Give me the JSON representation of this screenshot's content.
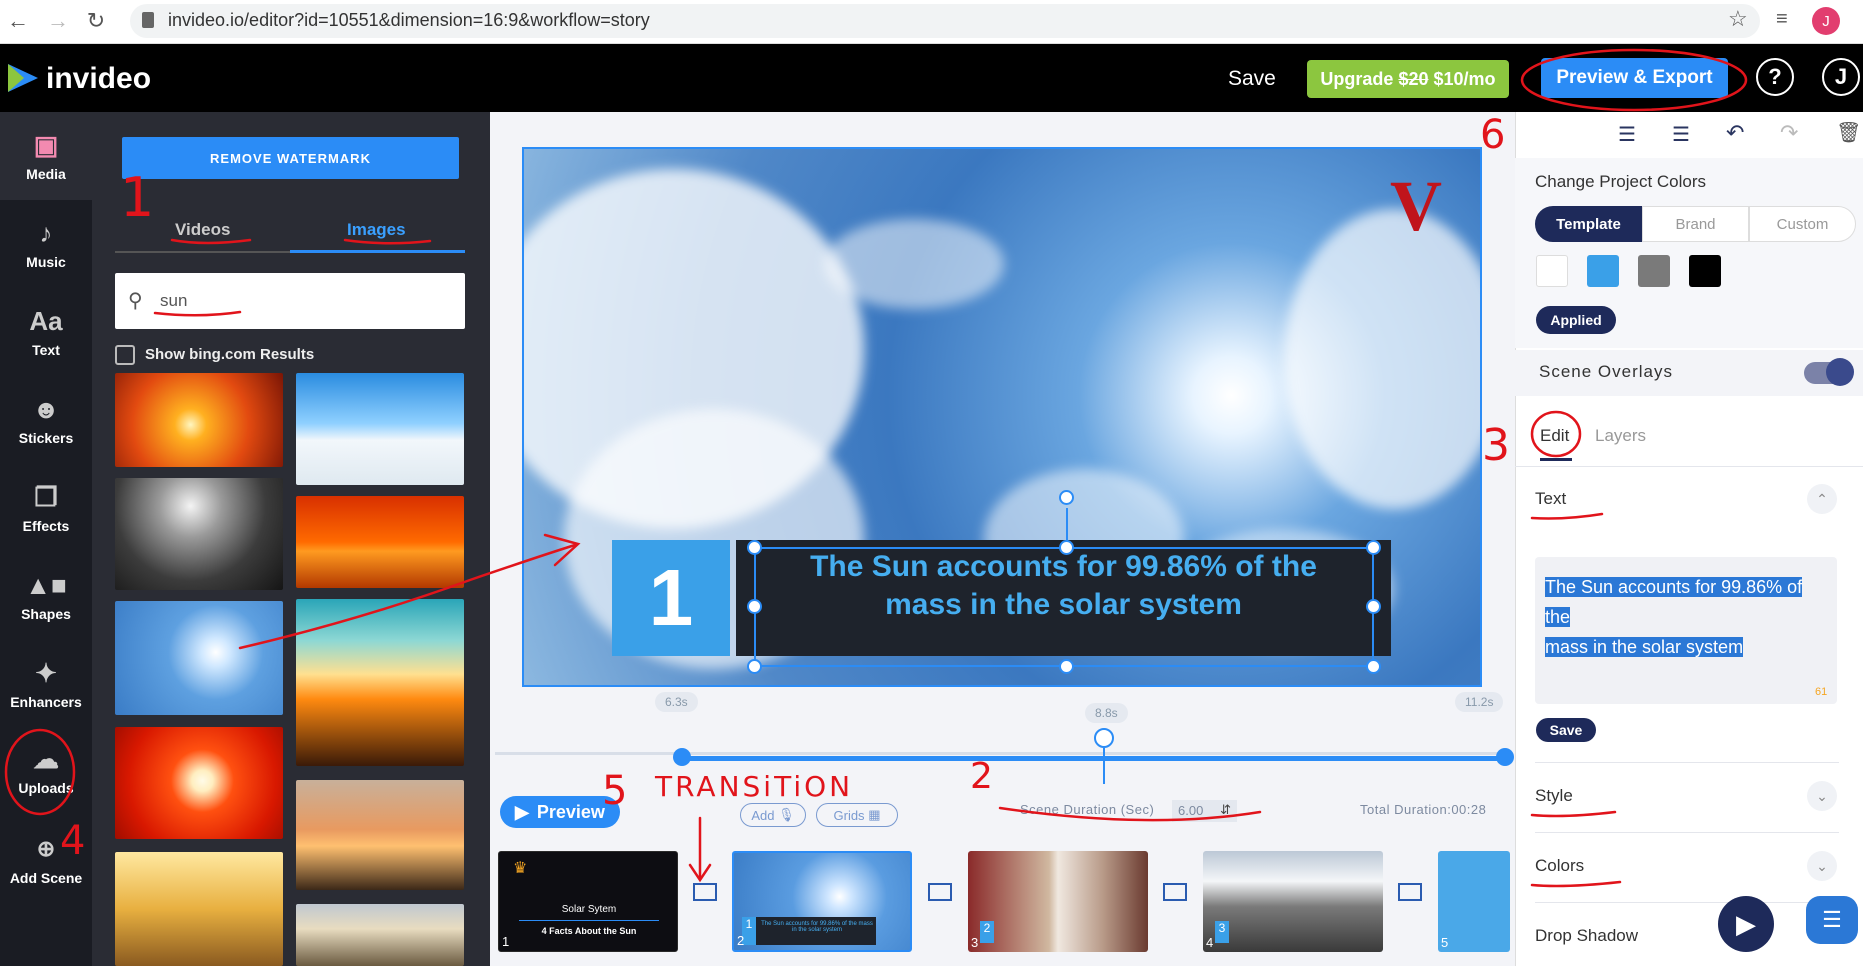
{
  "browser": {
    "url": "invideo.io/editor?id=10551&dimension=16:9&workflow=story",
    "avatar_letter": "J"
  },
  "header": {
    "logo": "invideo",
    "save_label": "Save",
    "upgrade_label": "Upgrade",
    "upgrade_old_price": "$20",
    "upgrade_price": "$10/mo",
    "preview_export_label": "Preview & Export",
    "help_label": "?",
    "user_initial": "J"
  },
  "rail": {
    "items": [
      {
        "label": "Media"
      },
      {
        "label": "Music"
      },
      {
        "label": "Text"
      },
      {
        "label": "Stickers"
      },
      {
        "label": "Effects"
      },
      {
        "label": "Shapes"
      },
      {
        "label": "Enhancers"
      },
      {
        "label": "Uploads"
      },
      {
        "label": "Add Scene"
      }
    ]
  },
  "media_panel": {
    "remove_watermark": "REMOVE WATERMARK",
    "tabs": [
      "Videos",
      "Images"
    ],
    "active_tab": "Images",
    "search_value": "sun",
    "bing_label": "Show bing.com Results"
  },
  "canvas": {
    "scene_number": "1",
    "caption_line1": "The Sun accounts for 99.86% of the",
    "caption_line2": "mass in the solar system",
    "logo_letter": "V"
  },
  "timeline": {
    "marker_start": "6.3s",
    "marker_mid": "8.8s",
    "marker_end": "11.2s",
    "preview_label": "Preview",
    "add_label": "Add",
    "grids_label": "Grids",
    "scene_duration_label": "Scene Duration (Sec)",
    "scene_duration_value": "6.00",
    "total_duration": "Total Duration:00:28",
    "scenes": [
      {
        "num": "1",
        "title": "Solar Sytem",
        "subtitle": "4 Facts About the Sun"
      },
      {
        "num": "2",
        "badge": "1",
        "text": "The Sun accounts for 99.86% of the mass in the solar system"
      },
      {
        "num": "3",
        "badge": "2"
      },
      {
        "num": "4",
        "badge": "3"
      },
      {
        "num": "5"
      }
    ]
  },
  "right_panel": {
    "change_colors_title": "Change Project Colors",
    "segments": [
      "Template",
      "Brand",
      "Custom"
    ],
    "active_segment": "Template",
    "swatches": [
      "#ffffff",
      "#3aa0e8",
      "#7a7a7a",
      "#000000"
    ],
    "applied_label": "Applied",
    "scene_overlays_label": "Scene Overlays",
    "tabs": [
      "Edit",
      "Layers"
    ],
    "active_tab": "Edit",
    "text_section": "Text",
    "textarea_line1": "The Sun accounts for 99.86% of",
    "textarea_line2": "the",
    "textarea_line3": "mass in the solar system",
    "char_count": "61",
    "save_label": "Save",
    "style_section": "Style",
    "colors_section": "Colors",
    "drop_shadow_section": "Drop Shadow"
  },
  "annotations": {
    "one": "1",
    "two": "2",
    "three": "3",
    "four": "4",
    "five": "5",
    "six": "6",
    "transition": "TRANSiTiON"
  }
}
